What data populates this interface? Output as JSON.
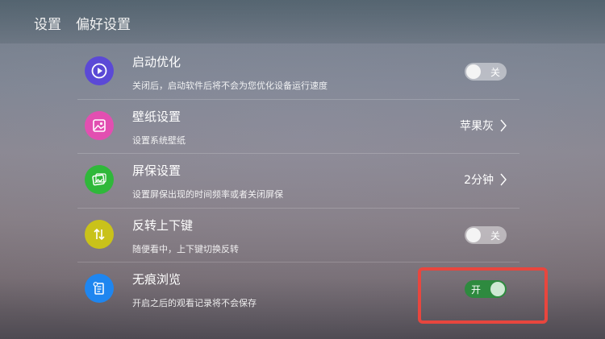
{
  "header": {
    "breadcrumb": [
      "设置",
      "偏好设置"
    ]
  },
  "colors": {
    "highlight": "#e8463e",
    "toggle_on": "#2e8a3f"
  },
  "settings": [
    {
      "title": "启动优化",
      "desc": "关闭后，启动软件后将不会为您优化设备运行速度",
      "icon": "play-icon",
      "icon_color": "#5b49d6",
      "control": "toggle",
      "state": "关"
    },
    {
      "title": "壁纸设置",
      "desc": "设置系统壁纸",
      "icon": "wallpaper-icon",
      "icon_color": "#e24fb1",
      "control": "value",
      "value": "苹果灰"
    },
    {
      "title": "屏保设置",
      "desc": "设置屏保出现的时间频率或者关闭屏保",
      "icon": "screensaver-icon",
      "icon_color": "#2fb83a",
      "control": "value",
      "value": "2分钟"
    },
    {
      "title": "反转上下键",
      "desc": "随便看中，上下键切换反转",
      "icon": "up-down-arrows-icon",
      "icon_color": "#c9c21a",
      "control": "toggle",
      "state": "关"
    },
    {
      "title": "无痕浏览",
      "desc": "开启之后的观看记录将不会保存",
      "icon": "document-icon",
      "icon_color": "#1e86f0",
      "control": "toggle",
      "state": "开"
    }
  ]
}
